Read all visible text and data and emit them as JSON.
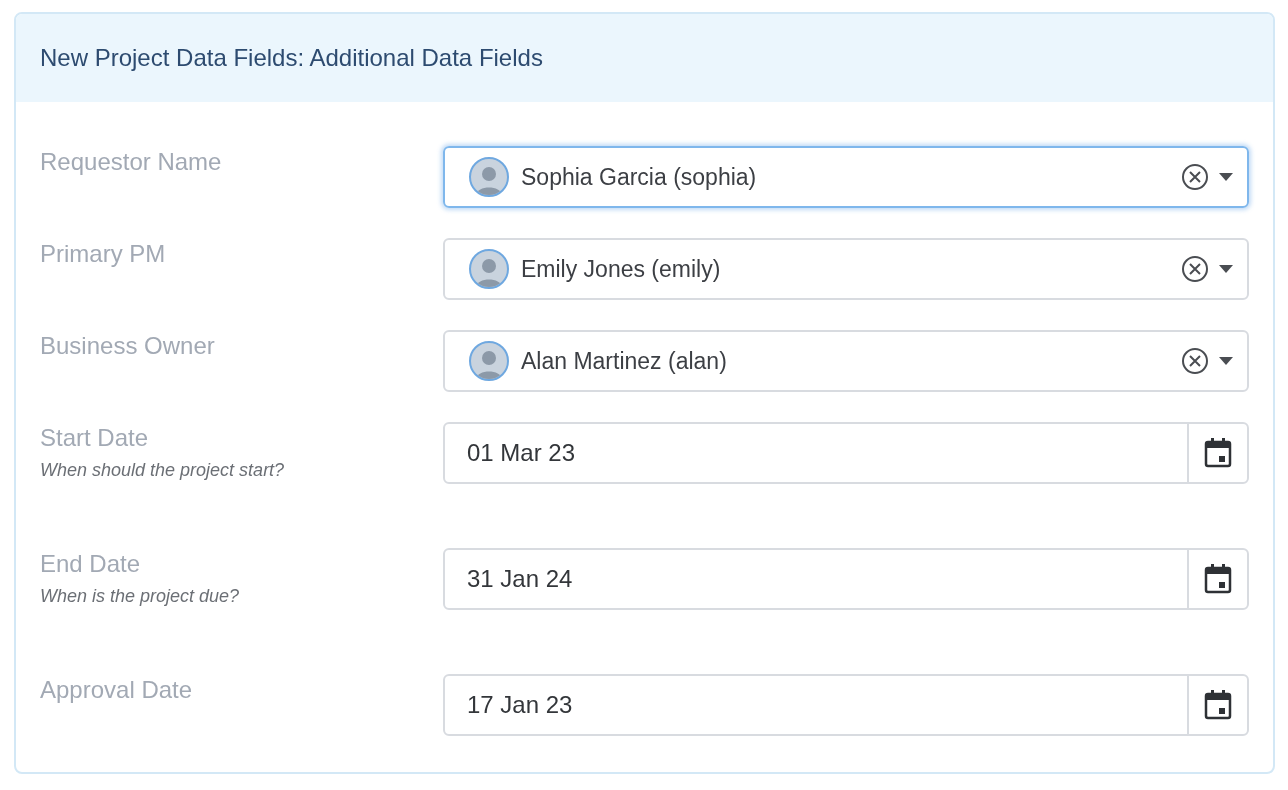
{
  "panel": {
    "title": "New Project Data Fields: Additional Data Fields"
  },
  "fields": [
    {
      "kind": "person",
      "label": "Requestor Name",
      "value": "Sophia Garcia (sophia)",
      "focused": true
    },
    {
      "kind": "person",
      "label": "Primary PM",
      "value": "Emily Jones (emily)",
      "focused": false
    },
    {
      "kind": "person",
      "label": "Business Owner",
      "value": "Alan Martinez (alan)",
      "focused": false
    },
    {
      "kind": "date",
      "label": "Start Date",
      "hint": "When should the project start?",
      "value": "01 Mar 23"
    },
    {
      "kind": "date",
      "label": "End Date",
      "hint": "When is the project due?",
      "value": "31 Jan 24"
    },
    {
      "kind": "date",
      "label": "Approval Date",
      "value": "17 Jan 23"
    }
  ]
}
